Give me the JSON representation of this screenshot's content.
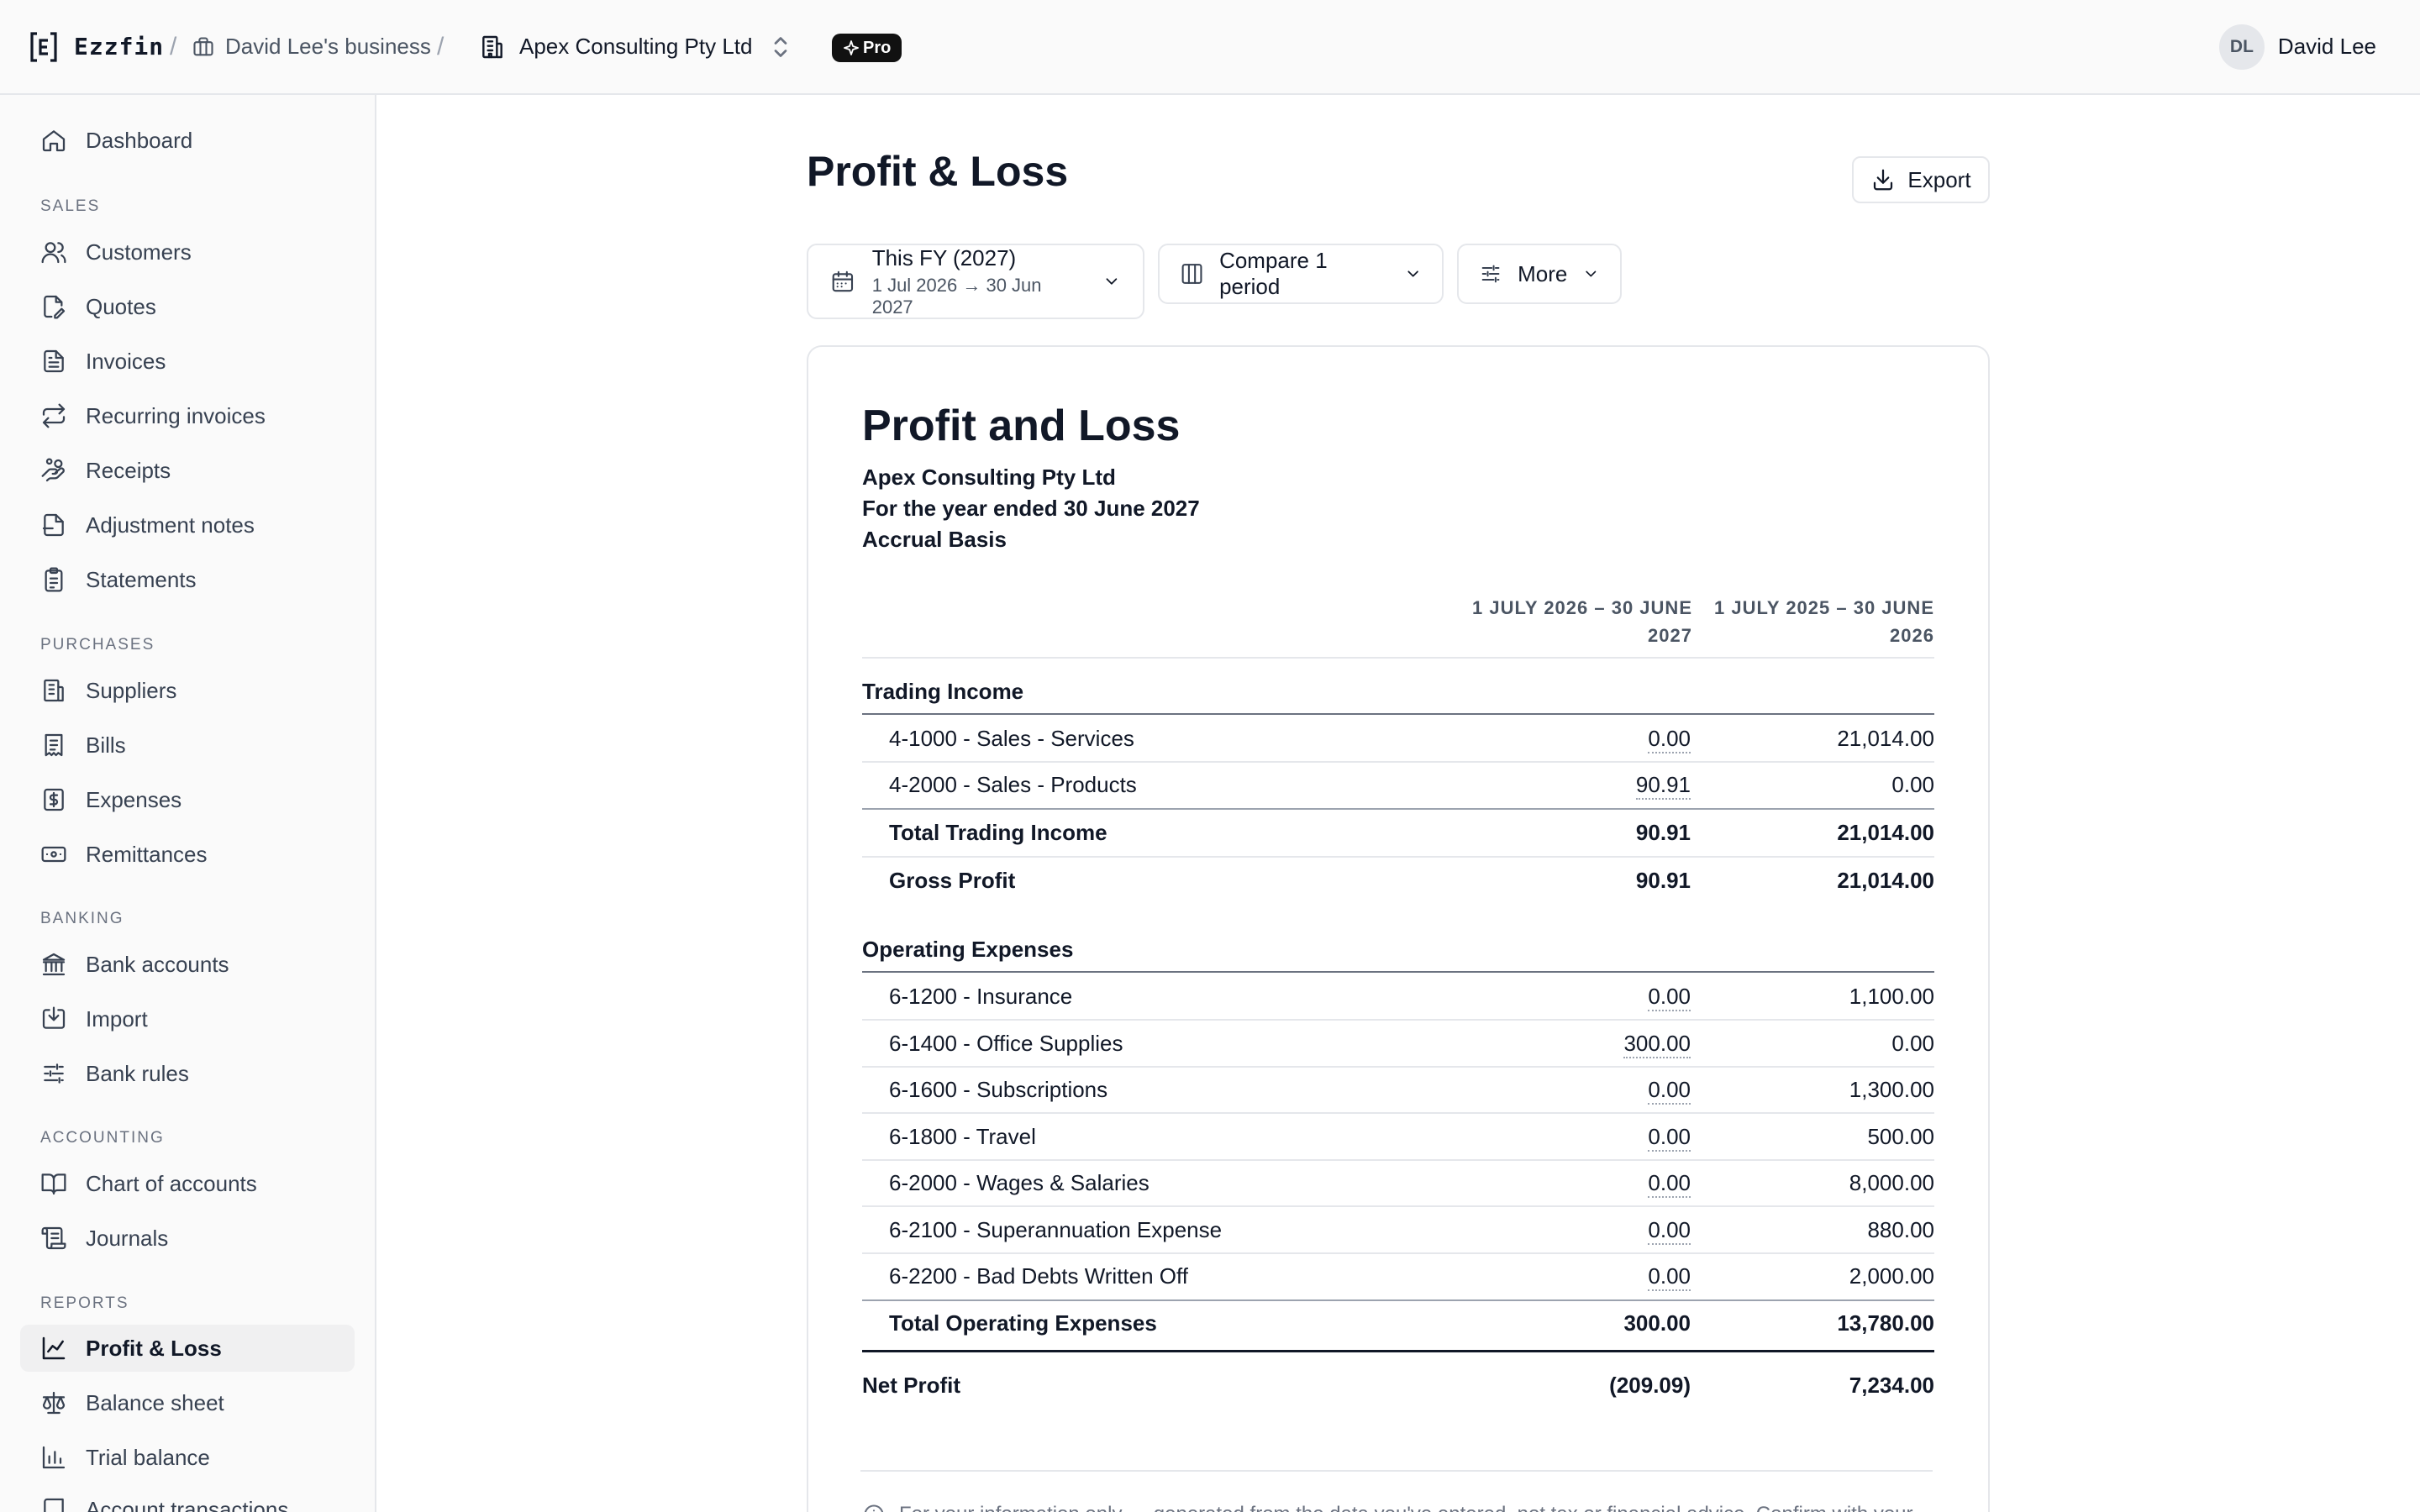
{
  "app": {
    "name": "Ezzfin",
    "breadcrumb_business": "David Lee's business",
    "breadcrumb_company": "Apex Consulting Pty Ltd",
    "badge": "Pro",
    "user_name": "David Lee",
    "user_initials": "DL"
  },
  "sidebar": {
    "dashboard": "Dashboard",
    "sales_heading": "Sales",
    "customers": "Customers",
    "quotes": "Quotes",
    "invoices": "Invoices",
    "recurring_invoices": "Recurring invoices",
    "receipts": "Receipts",
    "adjustment_notes": "Adjustment notes",
    "statements": "Statements",
    "purchases_heading": "Purchases",
    "suppliers": "Suppliers",
    "bills": "Bills",
    "expenses": "Expenses",
    "remittances": "Remittances",
    "banking_heading": "Banking",
    "bank_accounts": "Bank accounts",
    "import": "Import",
    "bank_rules": "Bank rules",
    "accounting_heading": "Accounting",
    "chart_of_accounts": "Chart of accounts",
    "journals": "Journals",
    "reports_heading": "Reports",
    "profit_loss": "Profit & Loss",
    "balance_sheet": "Balance sheet",
    "trial_balance": "Trial balance",
    "account_transactions": "Account transactions"
  },
  "page": {
    "title": "Profit & Loss",
    "export_label": "Export"
  },
  "filters": {
    "period_label": "This FY (2027)",
    "period_range": "1 Jul 2026 → 30 Jun 2027",
    "compare_label": "Compare 1 period",
    "more_label": "More"
  },
  "report": {
    "title": "Profit and Loss",
    "company": "Apex Consulting Pty Ltd",
    "period_text": "For the year ended 30 June 2027",
    "basis": "Accrual Basis",
    "col1_line1": "1 July 2026 – 30 June",
    "col1_line2": "2027",
    "col2_line1": "1 July 2025 – 30 June",
    "col2_line2": "2026",
    "trading_income_heading": "Trading Income",
    "income_rows": [
      {
        "label": "4-1000 - Sales - Services",
        "v1": "0.00",
        "v2": "21,014.00"
      },
      {
        "label": "4-2000 - Sales - Products",
        "v1": "90.91",
        "v2": "0.00"
      }
    ],
    "total_trading_income": {
      "label": "Total Trading Income",
      "v1": "90.91",
      "v2": "21,014.00"
    },
    "gross_profit": {
      "label": "Gross Profit",
      "v1": "90.91",
      "v2": "21,014.00"
    },
    "operating_expenses_heading": "Operating Expenses",
    "expense_rows": [
      {
        "label": "6-1200 - Insurance",
        "v1": "0.00",
        "v2": "1,100.00"
      },
      {
        "label": "6-1400 - Office Supplies",
        "v1": "300.00",
        "v2": "0.00"
      },
      {
        "label": "6-1600 - Subscriptions",
        "v1": "0.00",
        "v2": "1,300.00"
      },
      {
        "label": "6-1800 - Travel",
        "v1": "0.00",
        "v2": "500.00"
      },
      {
        "label": "6-2000 - Wages & Salaries",
        "v1": "0.00",
        "v2": "8,000.00"
      },
      {
        "label": "6-2100 - Superannuation Expense",
        "v1": "0.00",
        "v2": "880.00"
      },
      {
        "label": "6-2200 - Bad Debts Written Off",
        "v1": "0.00",
        "v2": "2,000.00"
      }
    ],
    "total_operating_expenses": {
      "label": "Total Operating Expenses",
      "v1": "300.00",
      "v2": "13,780.00"
    },
    "net_profit": {
      "label": "Net Profit",
      "v1": "(209.09)",
      "v2": "7,234.00"
    },
    "footnote": "For your information only — generated from the data you've entered, not tax or financial advice. Confirm with your"
  }
}
